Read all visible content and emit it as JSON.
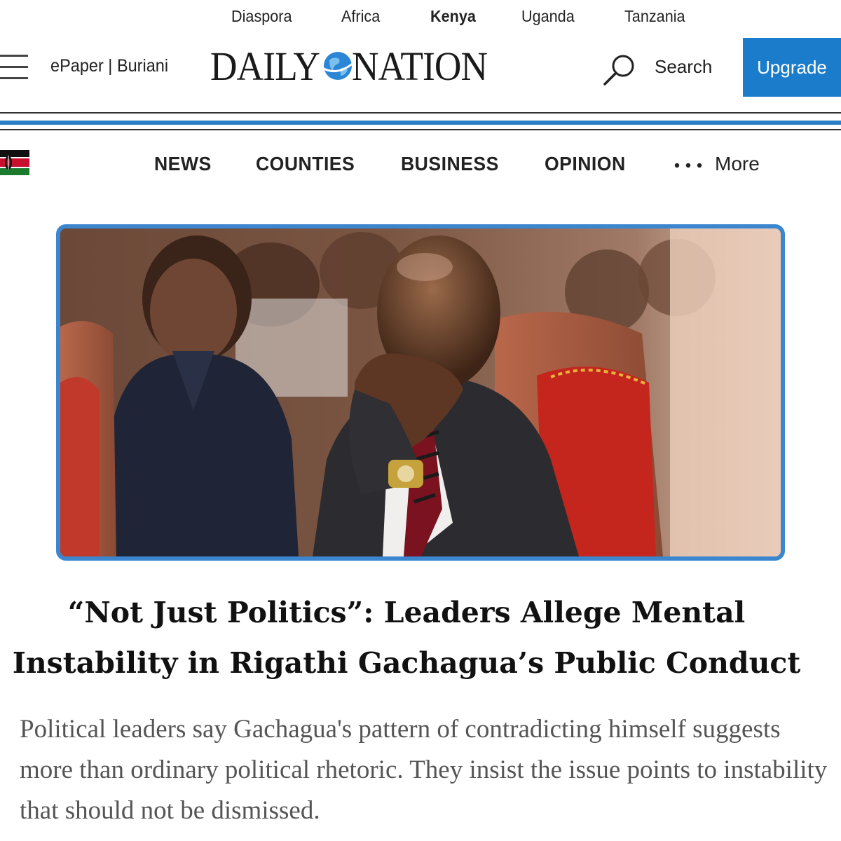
{
  "region_nav": [
    "Diaspora",
    "Africa",
    "Kenya",
    "Uganda",
    "Tanzania"
  ],
  "region_active": "Kenya",
  "header": {
    "epaper_label": "ePaper | Buriani",
    "logo_left": "DAILY",
    "logo_right": "NATION",
    "search_label": "Search",
    "upgrade_label": "Upgrade"
  },
  "section_nav": {
    "items": [
      "NEWS",
      "COUNTIES",
      "BUSINESS",
      "OPINION"
    ],
    "more_label": "More"
  },
  "article": {
    "headline_line1": "“Not Just Politics”: Leaders Allege Mental",
    "headline_line2": "Instability in Rigathi Gachagua’s Public Conduct",
    "summary": "Political leaders say Gachagua's pattern of contradicting himself suggests more than ordinary political rhetoric. They insist the issue points to instability that should not be dismissed."
  },
  "colors": {
    "brand_blue": "#1b7ccb",
    "hero_border": "#3b86cf"
  },
  "icons": {
    "menu": "hamburger-menu-icon",
    "search": "search-icon",
    "flag": "kenya-flag-icon",
    "more": "more-dots-icon",
    "globe": "globe-icon"
  }
}
